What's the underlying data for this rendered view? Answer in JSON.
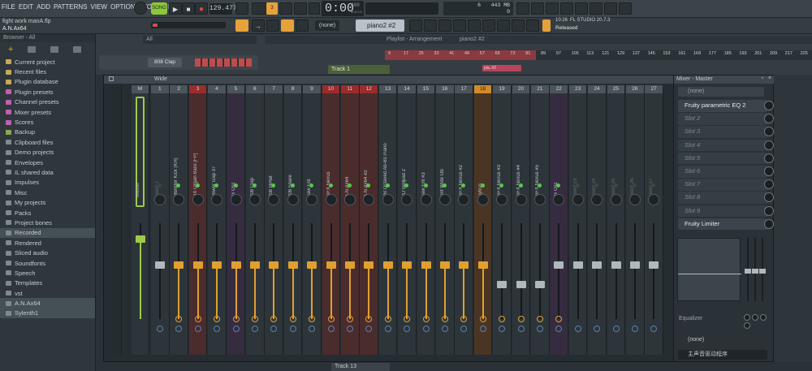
{
  "menu": [
    "FILE",
    "EDIT",
    "ADD",
    "PATTERNS",
    "VIEW",
    "OPTIONS",
    "TOOLS",
    "HELP"
  ],
  "project": {
    "file": "fight work manA.flp",
    "user": "A.N.Ax64"
  },
  "transport": {
    "mode": "SONG",
    "tempo": "129.477",
    "time": "0:00",
    "time_sub": "000",
    "time_unit": "M:S:CS"
  },
  "cpu": {
    "value": "6",
    "memory": "443 MB",
    "polyphony": "0"
  },
  "fl_info": {
    "time": "10:26",
    "version": "FL STUDIO 20.7.3",
    "status": "Released"
  },
  "pattern": {
    "none_label": "(none)",
    "current": "piano2 #2"
  },
  "browser": {
    "header": "Browser - All",
    "items": [
      {
        "label": "Current project",
        "color": "#c9a85a",
        "selected": false
      },
      {
        "label": "Recent files",
        "color": "#c9a85a",
        "selected": false
      },
      {
        "label": "Plugin database",
        "color": "#c9a85a",
        "selected": false
      },
      {
        "label": "Plugin presets",
        "color": "#c060b0",
        "selected": false
      },
      {
        "label": "Channel presets",
        "color": "#c060b0",
        "selected": false
      },
      {
        "label": "Mixer presets",
        "color": "#c060b0",
        "selected": false
      },
      {
        "label": "Scores",
        "color": "#c060b0",
        "selected": false
      },
      {
        "label": "Backup",
        "color": "#8aa856",
        "selected": false
      },
      {
        "label": "Clipboard files",
        "color": "#7e8a90",
        "selected": false
      },
      {
        "label": "Demo projects",
        "color": "#7e8a90",
        "selected": false
      },
      {
        "label": "Envelopes",
        "color": "#7e8a90",
        "selected": false
      },
      {
        "label": "IL shared data",
        "color": "#7e8a90",
        "selected": false
      },
      {
        "label": "Impulses",
        "color": "#7e8a90",
        "selected": false
      },
      {
        "label": "Misc",
        "color": "#7e8a90",
        "selected": false
      },
      {
        "label": "My projects",
        "color": "#7e8a90",
        "selected": false
      },
      {
        "label": "Packs",
        "color": "#7e8a90",
        "selected": false
      },
      {
        "label": "Project bones",
        "color": "#7e8a90",
        "selected": false
      },
      {
        "label": "Recorded",
        "color": "#7e8a90",
        "selected": true
      },
      {
        "label": "Rendered",
        "color": "#7e8a90",
        "selected": false
      },
      {
        "label": "Sliced audio",
        "color": "#7e8a90",
        "selected": false
      },
      {
        "label": "Soundfonts",
        "color": "#7e8a90",
        "selected": false
      },
      {
        "label": "Speech",
        "color": "#7e8a90",
        "selected": false
      },
      {
        "label": "Templates",
        "color": "#7e8a90",
        "selected": false
      },
      {
        "label": "vst",
        "color": "#7e8a90",
        "selected": false
      },
      {
        "label": "A.N.Ax64",
        "color": "#7e8a90",
        "selected": true
      },
      {
        "label": "Sylenth1",
        "color": "#7e8a90",
        "selected": true
      }
    ]
  },
  "channel_rack": {
    "all_label": "All",
    "channel": "808 Clap"
  },
  "playlist": {
    "title": "Playlist - Arrangement",
    "pattern": "piano2 #2",
    "track": "Track 1",
    "track_bottom": "Track 13",
    "clip_label": "pia..#2",
    "ruler": [
      "9",
      "17",
      "25",
      "33",
      "41",
      "49",
      "57",
      "65",
      "73",
      "81",
      "89",
      "97",
      "105",
      "113",
      "121",
      "129",
      "137",
      "145",
      "153",
      "161",
      "169",
      "177",
      "185",
      "193",
      "201",
      "209",
      "217",
      "225"
    ]
  },
  "mixer": {
    "view": "Wide",
    "master_num": "M",
    "tracks": [
      {
        "num": "1",
        "name": "Insert 1",
        "tint": "",
        "numstyle": "",
        "level": 0.8
      },
      {
        "num": "2",
        "name": "Monster Kick (KH)",
        "tint": "",
        "numstyle": "",
        "level": 0.8
      },
      {
        "num": "3",
        "name": "DX Organ Bass [FP]",
        "tint": "red",
        "numstyle": "red",
        "level": 0.8
      },
      {
        "num": "4",
        "name": "Power Gap 37",
        "tint": "",
        "numstyle": "",
        "level": 0.8
      },
      {
        "num": "5",
        "name": "3x Osc",
        "tint": "purple",
        "numstyle": "",
        "level": 0.8
      },
      {
        "num": "6",
        "name": "808 Clap",
        "tint": "",
        "numstyle": "",
        "level": 0.8
      },
      {
        "num": "7",
        "name": "808 HiHat",
        "tint": "",
        "numstyle": "",
        "level": 0.8
      },
      {
        "num": "8",
        "name": "808 Snare",
        "tint": "",
        "numstyle": "",
        "level": 0.8
      },
      {
        "num": "9",
        "name": "Saw Ent",
        "tint": "",
        "numstyle": "",
        "level": 0.8
      },
      {
        "num": "10",
        "name": "reFX Nexus",
        "tint": "red",
        "numstyle": "red",
        "level": 0.8
      },
      {
        "num": "11",
        "name": "A.N.Ax64",
        "tint": "red",
        "numstyle": "red",
        "level": 0.8
      },
      {
        "num": "12",
        "name": "A.N.Ax64 #2",
        "tint": "red",
        "numstyle": "red",
        "level": 0.8
      },
      {
        "num": "13",
        "name": "PB Octaved Ab-Bs Piano",
        "tint": "",
        "numstyle": "",
        "level": 0.8
      },
      {
        "num": "14",
        "name": "PD Bellpad 2",
        "tint": "",
        "numstyle": "",
        "level": 0.8
      },
      {
        "num": "15",
        "name": "Saw Ent #3",
        "tint": "",
        "numstyle": "",
        "level": 0.8
      },
      {
        "num": "16",
        "name": "Grit Wide Ob",
        "tint": "",
        "numstyle": "",
        "level": 0.8
      },
      {
        "num": "17",
        "name": "reFX Nexus #2",
        "tint": "",
        "numstyle": "",
        "level": 0.8
      },
      {
        "num": "18",
        "name": "Sytrus",
        "tint": "orange",
        "numstyle": "orange",
        "level": 0.8
      },
      {
        "num": "19",
        "name": "reFX Nexus #3",
        "tint": "",
        "numstyle": "",
        "level": 0.7
      },
      {
        "num": "20",
        "name": "reFX Nexus #4",
        "tint": "",
        "numstyle": "",
        "level": 0.7
      },
      {
        "num": "21",
        "name": "reFX Nexus #5",
        "tint": "",
        "numstyle": "",
        "level": 0.7
      },
      {
        "num": "22",
        "name": "3x Osc",
        "tint": "purple",
        "numstyle": "",
        "level": 0.8
      },
      {
        "num": "23",
        "name": "Insert 23",
        "tint": "",
        "numstyle": "",
        "level": 0.8
      },
      {
        "num": "24",
        "name": "Insert 24",
        "tint": "",
        "numstyle": "",
        "level": 0.8
      },
      {
        "num": "25",
        "name": "Insert 25",
        "tint": "",
        "numstyle": "",
        "level": 0.8
      },
      {
        "num": "26",
        "name": "Insert 26",
        "tint": "",
        "numstyle": "",
        "level": 0.8
      },
      {
        "num": "27",
        "name": "Insert 27",
        "tint": "",
        "numstyle": "",
        "level": 0.8
      }
    ],
    "master_name": "Master"
  },
  "insert_panel": {
    "title": "Mixer - Master",
    "input": "(none)",
    "slots": [
      {
        "label": "Fruity parametric EQ 2",
        "active": true
      },
      {
        "label": "Slot 2",
        "active": false
      },
      {
        "label": "Slot 3",
        "active": false
      },
      {
        "label": "Slot 4",
        "active": false
      },
      {
        "label": "Slot 5",
        "active": false
      },
      {
        "label": "Slot 6",
        "active": false
      },
      {
        "label": "Slot 7",
        "active": false
      },
      {
        "label": "Slot 8",
        "active": false
      },
      {
        "label": "Slot 9",
        "active": false
      },
      {
        "label": "Fruity Limiter",
        "active": true
      }
    ],
    "eq_label": "Equalizer",
    "output": "(none)",
    "output_device": "主声音驱动程序"
  }
}
